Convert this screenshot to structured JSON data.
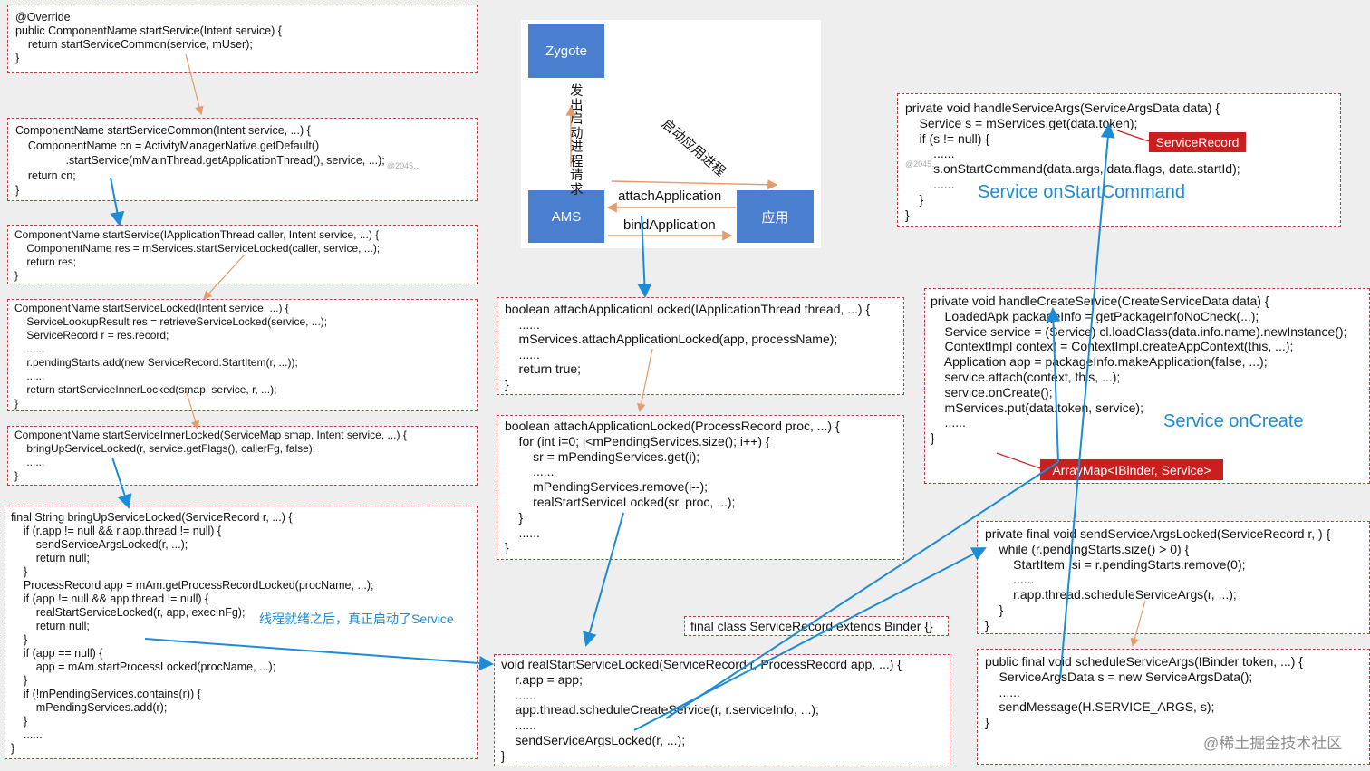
{
  "boxes": {
    "b1": [
      "@Override",
      "public ComponentName startService(Intent service) {",
      "    return startServiceCommon(service, mUser);",
      "}"
    ],
    "b2": [
      "ComponentName startServiceCommon(Intent service, ...) {",
      "    ComponentName cn = ActivityManagerNative.getDefault()",
      "                .startService(mMainThread.getApplicationThread(), service, ...);",
      "    return cn;",
      "}"
    ],
    "b3": [
      "ComponentName startService(IApplicationThread caller, Intent service, ...) {",
      "    ComponentName res = mServices.startServiceLocked(caller, service, ...);",
      "    return res;",
      "}"
    ],
    "b4": [
      "ComponentName startServiceLocked(Intent service, ...) {",
      "    ServiceLookupResult res = retrieveServiceLocked(service, ...);",
      "    ServiceRecord r = res.record;",
      "    ......",
      "    r.pendingStarts.add(new ServiceRecord.StartItem(r, ...));",
      "    ......",
      "    return startServiceInnerLocked(smap, service, r, ...);",
      "}"
    ],
    "b5": [
      "ComponentName startServiceInnerLocked(ServiceMap smap, Intent service, ...) {",
      "    bringUpServiceLocked(r, service.getFlags(), callerFg, false);",
      "    ......",
      "}"
    ],
    "b6": [
      "final String bringUpServiceLocked(ServiceRecord r, ...) {",
      "    if (r.app != null && r.app.thread != null) {",
      "        sendServiceArgsLocked(r, ...);",
      "        return null;",
      "    }",
      "    ProcessRecord app = mAm.getProcessRecordLocked(procName, ...);",
      "    if (app != null && app.thread != null) {",
      "        realStartServiceLocked(r, app, execInFg);",
      "        return null;",
      "    }",
      "    if (app == null) {",
      "        app = mAm.startProcessLocked(procName, ...);",
      "    }",
      "    if (!mPendingServices.contains(r)) {",
      "        mPendingServices.add(r);",
      "    }",
      "    ......",
      "}"
    ],
    "b7": [
      "boolean attachApplicationLocked(IApplicationThread thread, ...) {",
      "    ......",
      "    mServices.attachApplicationLocked(app, processName);",
      "    ......",
      "    return true;",
      "}"
    ],
    "b8": [
      "boolean attachApplicationLocked(ProcessRecord proc, ...) {",
      "    for (int i=0; i<mPendingServices.size(); i++) {",
      "        sr = mPendingServices.get(i);",
      "        ......",
      "        mPendingServices.remove(i--);",
      "        realStartServiceLocked(sr, proc, ...);",
      "    }",
      "    ......",
      "}"
    ],
    "b9": [
      "final class ServiceRecord extends Binder {}"
    ],
    "b10": [
      "void realStartServiceLocked(ServiceRecord r, ProcessRecord app, ...) {",
      "    r.app = app;",
      "    ......",
      "    app.thread.scheduleCreateService(r, r.serviceInfo, ...);",
      "    ......",
      "    sendServiceArgsLocked(r, ...);",
      "}"
    ],
    "b11": [
      "private void handleServiceArgs(ServiceArgsData data) {",
      "    Service s = mServices.get(data.token);",
      "    if (s != null) {",
      "        ......",
      "        s.onStartCommand(data.args, data.flags, data.startId);",
      "        ......",
      "    }",
      "}"
    ],
    "b12": [
      "private void handleCreateService(CreateServiceData data) {",
      "    LoadedApk packageInfo = getPackageInfoNoCheck(...);",
      "    Service service = (Service) cl.loadClass(data.info.name).newInstance();",
      "",
      "    ContextImpl context = ContextImpl.createAppContext(this, ...);",
      "",
      "    Application app = packageInfo.makeApplication(false, ...);",
      "    service.attach(context, this, ...);",
      "    service.onCreate();",
      "    mServices.put(data.token, service);",
      "    ......",
      "}"
    ],
    "b13": [
      "private final void sendServiceArgsLocked(ServiceRecord r, ) {",
      "    while (r.pendingStarts.size() > 0) {",
      "        StartItem  si = r.pendingStarts.remove(0);",
      "        ......",
      "        r.app.thread.scheduleServiceArgs(r, ...);",
      "    }",
      "}"
    ],
    "b14": [
      "public final void scheduleServiceArgs(IBinder token, ...) {",
      "    ServiceArgsData s = new ServiceArgsData();",
      "    ......",
      "",
      "    sendMessage(H.SERVICE_ARGS, s);",
      "}"
    ]
  },
  "panel": {
    "zygote": "Zygote",
    "ams": "AMS",
    "app": "应用",
    "vertical_caption": "发出启动进程请求",
    "diagonal_caption": "启动应用进程",
    "attach_label": "attachApplication",
    "bind_label": "bindApplication"
  },
  "notes": {
    "service_ready": "线程就绪之后，真正启动了Service",
    "on_start_command": "Service onStartCommand",
    "on_create": "Service onCreate"
  },
  "tags": {
    "service_record": "ServiceRecord",
    "array_map": "ArrayMap<IBinder, Service>"
  },
  "watermarks": {
    "w1": "@2045…",
    "w2": "@2045…",
    "site": "@稀土掘金技术社区"
  },
  "colors": {
    "border_dashed": "#c0393b",
    "keyword": "#c8792c",
    "method_name": "#f0b99a",
    "field": "#9c7fc0",
    "node_blue": "#4a7fd0",
    "tag_red": "#c9201f",
    "arrow_blue": "#1d8bd6",
    "arrow_orange": "#e59b6c"
  }
}
